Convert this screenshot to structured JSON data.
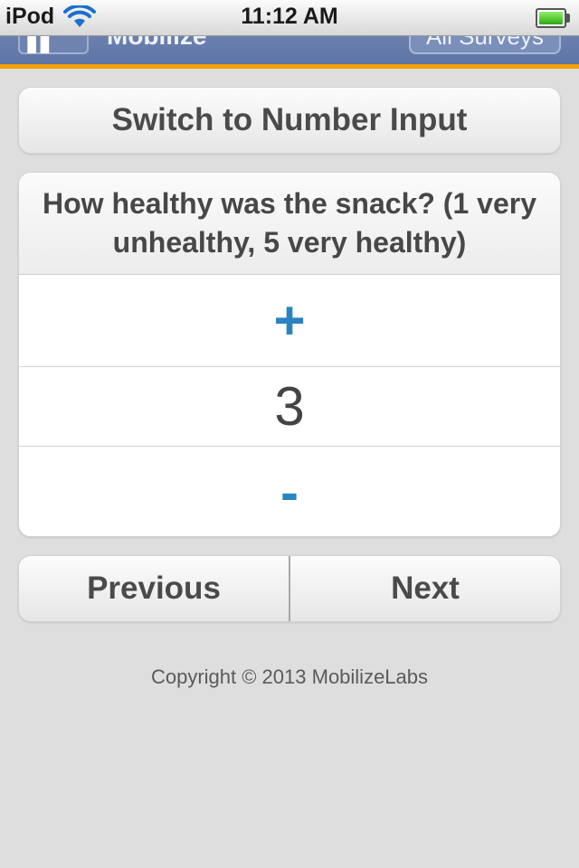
{
  "status_bar": {
    "carrier": "iPod",
    "wifi_icon": "wifi-icon",
    "time": "11:12 AM",
    "battery_icon": "battery-icon",
    "battery_level": 1.0
  },
  "header": {
    "title": "Mobilize",
    "home_icon": "home-icon",
    "right_button_label": "All Surveys",
    "accent_color": "#f5a000"
  },
  "switch_button_label": "Switch to Number Input",
  "question": {
    "text": "How healthy was the snack? (1 very unhealthy, 5 very healthy)",
    "increment_label": "+",
    "value": "3",
    "decrement_label": "-"
  },
  "navigation": {
    "previous_label": "Previous",
    "next_label": "Next"
  },
  "footer": {
    "copyright": "Copyright © 2013 MobilizeLabs"
  },
  "colors": {
    "stepper_accent": "#2a84c4",
    "background": "#dedede"
  }
}
